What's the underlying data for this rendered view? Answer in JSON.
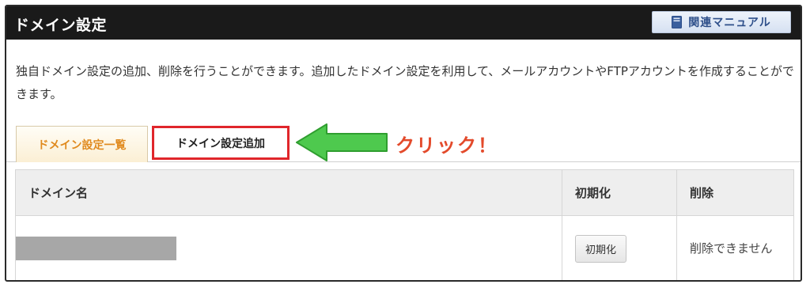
{
  "header": {
    "title": "ドメイン設定",
    "manual_button": "関連マニュアル"
  },
  "description": "独自ドメイン設定の追加、削除を行うことができます。追加したドメイン設定を利用して、メールアカウントやFTPアカウントを作成することができます。",
  "tabs": [
    {
      "label": "ドメイン設定一覧",
      "active": true
    },
    {
      "label": "ドメイン設定追加",
      "active": false
    }
  ],
  "annotation": {
    "text": "クリック！",
    "color": "#e34a2b",
    "arrow_color": "#4ec94e"
  },
  "table": {
    "columns": [
      "ドメイン名",
      "初期化",
      "削除"
    ],
    "rows": [
      {
        "domain": "",
        "init_button": "初期化",
        "delete_status": "削除できません"
      }
    ]
  },
  "colors": {
    "header_bg": "#1a1a1a",
    "active_tab_text": "#e08a1e",
    "highlight_border": "#e0262b"
  }
}
